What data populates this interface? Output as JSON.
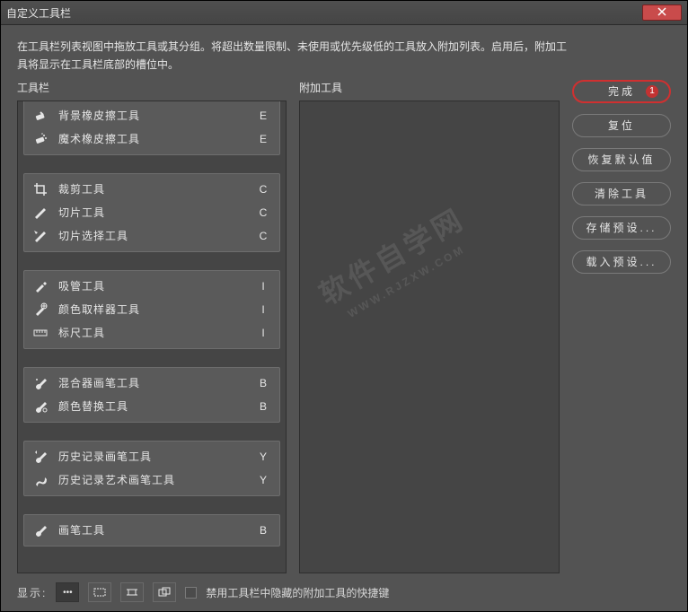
{
  "window": {
    "title": "自定义工具栏"
  },
  "instruction": "在工具栏列表视图中拖放工具或其分组。将超出数量限制、未使用或优先级低的工具放入附加列表。启用后，附加工具将显示在工具栏底部的槽位中。",
  "columns": {
    "toolbar": "工具栏",
    "extra": "附加工具"
  },
  "groups": [
    {
      "items": [
        {
          "icon": "bg-eraser-icon",
          "label": "背景橡皮擦工具",
          "shortcut": "E"
        },
        {
          "icon": "magic-eraser-icon",
          "label": "魔术橡皮擦工具",
          "shortcut": "E"
        }
      ]
    },
    {
      "items": [
        {
          "icon": "crop-icon",
          "label": "裁剪工具",
          "shortcut": "C"
        },
        {
          "icon": "slice-icon",
          "label": "切片工具",
          "shortcut": "C"
        },
        {
          "icon": "slice-select-icon",
          "label": "切片选择工具",
          "shortcut": "C"
        }
      ]
    },
    {
      "items": [
        {
          "icon": "eyedropper-icon",
          "label": "吸管工具",
          "shortcut": "I"
        },
        {
          "icon": "color-sampler-icon",
          "label": "颜色取样器工具",
          "shortcut": "I"
        },
        {
          "icon": "ruler-icon",
          "label": "标尺工具",
          "shortcut": "I"
        }
      ]
    },
    {
      "items": [
        {
          "icon": "mixer-brush-icon",
          "label": "混合器画笔工具",
          "shortcut": "B"
        },
        {
          "icon": "color-replace-icon",
          "label": "颜色替换工具",
          "shortcut": "B"
        }
      ]
    },
    {
      "items": [
        {
          "icon": "history-brush-icon",
          "label": "历史记录画笔工具",
          "shortcut": "Y"
        },
        {
          "icon": "art-history-brush-icon",
          "label": "历史记录艺术画笔工具",
          "shortcut": "Y"
        }
      ]
    },
    {
      "items": [
        {
          "icon": "brush-icon",
          "label": "画笔工具",
          "shortcut": "B"
        }
      ]
    }
  ],
  "buttons": {
    "done": "完成",
    "done_badge": "1",
    "reset": "复位",
    "restore_defaults": "恢复默认值",
    "clear_tools": "清除工具",
    "save_preset": "存储预设...",
    "load_preset": "载入预设..."
  },
  "footer": {
    "display_label": "显示:",
    "checkbox_label": "禁用工具栏中隐藏的附加工具的快捷键"
  },
  "watermark": {
    "main": "软件自学网",
    "sub": "WWW.RJZXW.COM"
  }
}
